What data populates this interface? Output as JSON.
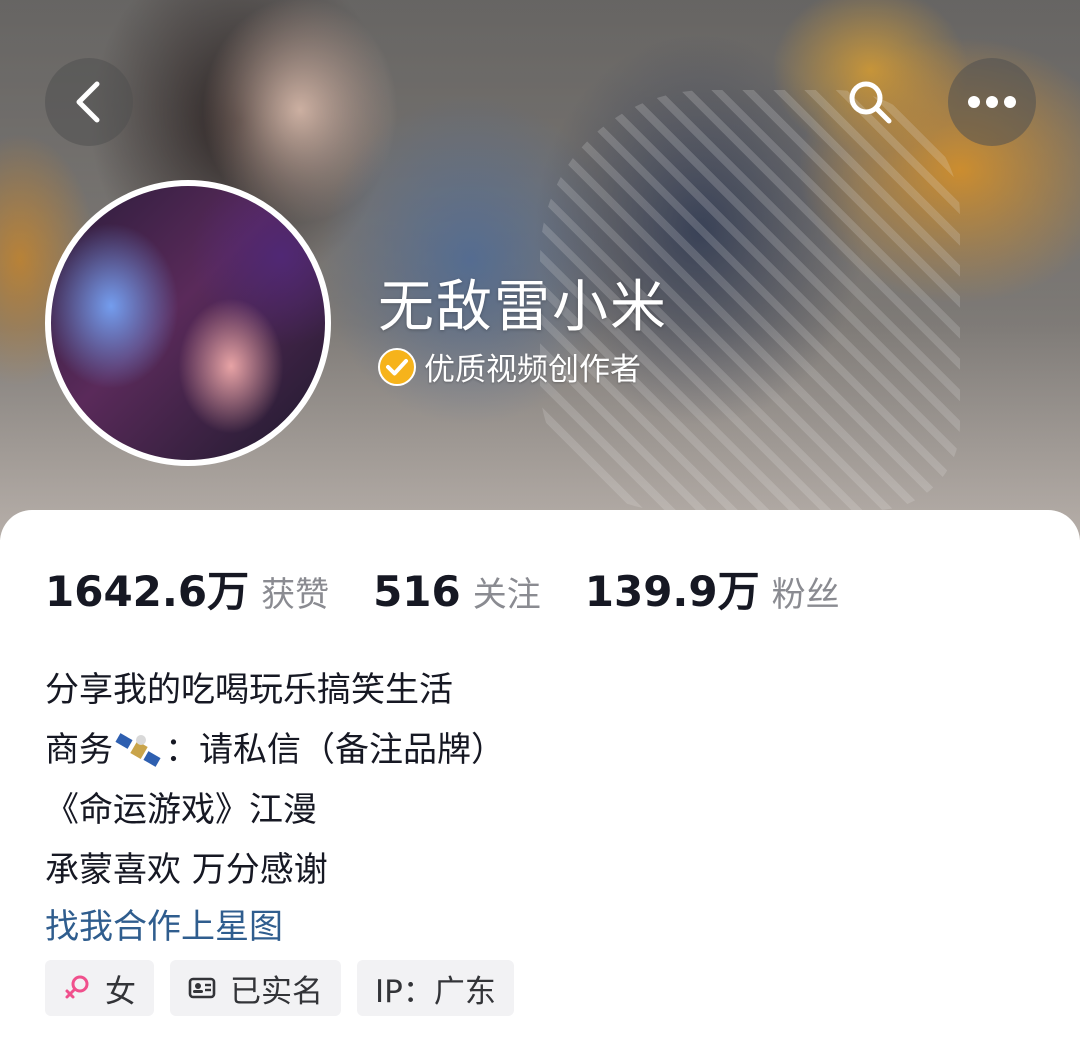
{
  "profile": {
    "username": "无敌雷小米",
    "verified_title": "优质视频创作者"
  },
  "stats": [
    {
      "number": "1642.6万",
      "label": "获赞"
    },
    {
      "number": "516",
      "label": "关注"
    },
    {
      "number": "139.9万",
      "label": "粉丝"
    }
  ],
  "bio": {
    "line1": "分享我的吃喝玩乐搞笑生活",
    "line2_prefix": "商务",
    "line2_suffix": "：请私信（备注品牌）",
    "line3": "《命运游戏》江漫",
    "line4": "承蒙喜欢 万分感谢",
    "link": "找我合作上星图"
  },
  "tags": {
    "gender": "女",
    "realname": "已实名",
    "ip": "IP：广东"
  },
  "colors": {
    "verify_badge": "#f6b31b",
    "link": "#2f5d8e",
    "gender_icon": "#f0508c"
  }
}
